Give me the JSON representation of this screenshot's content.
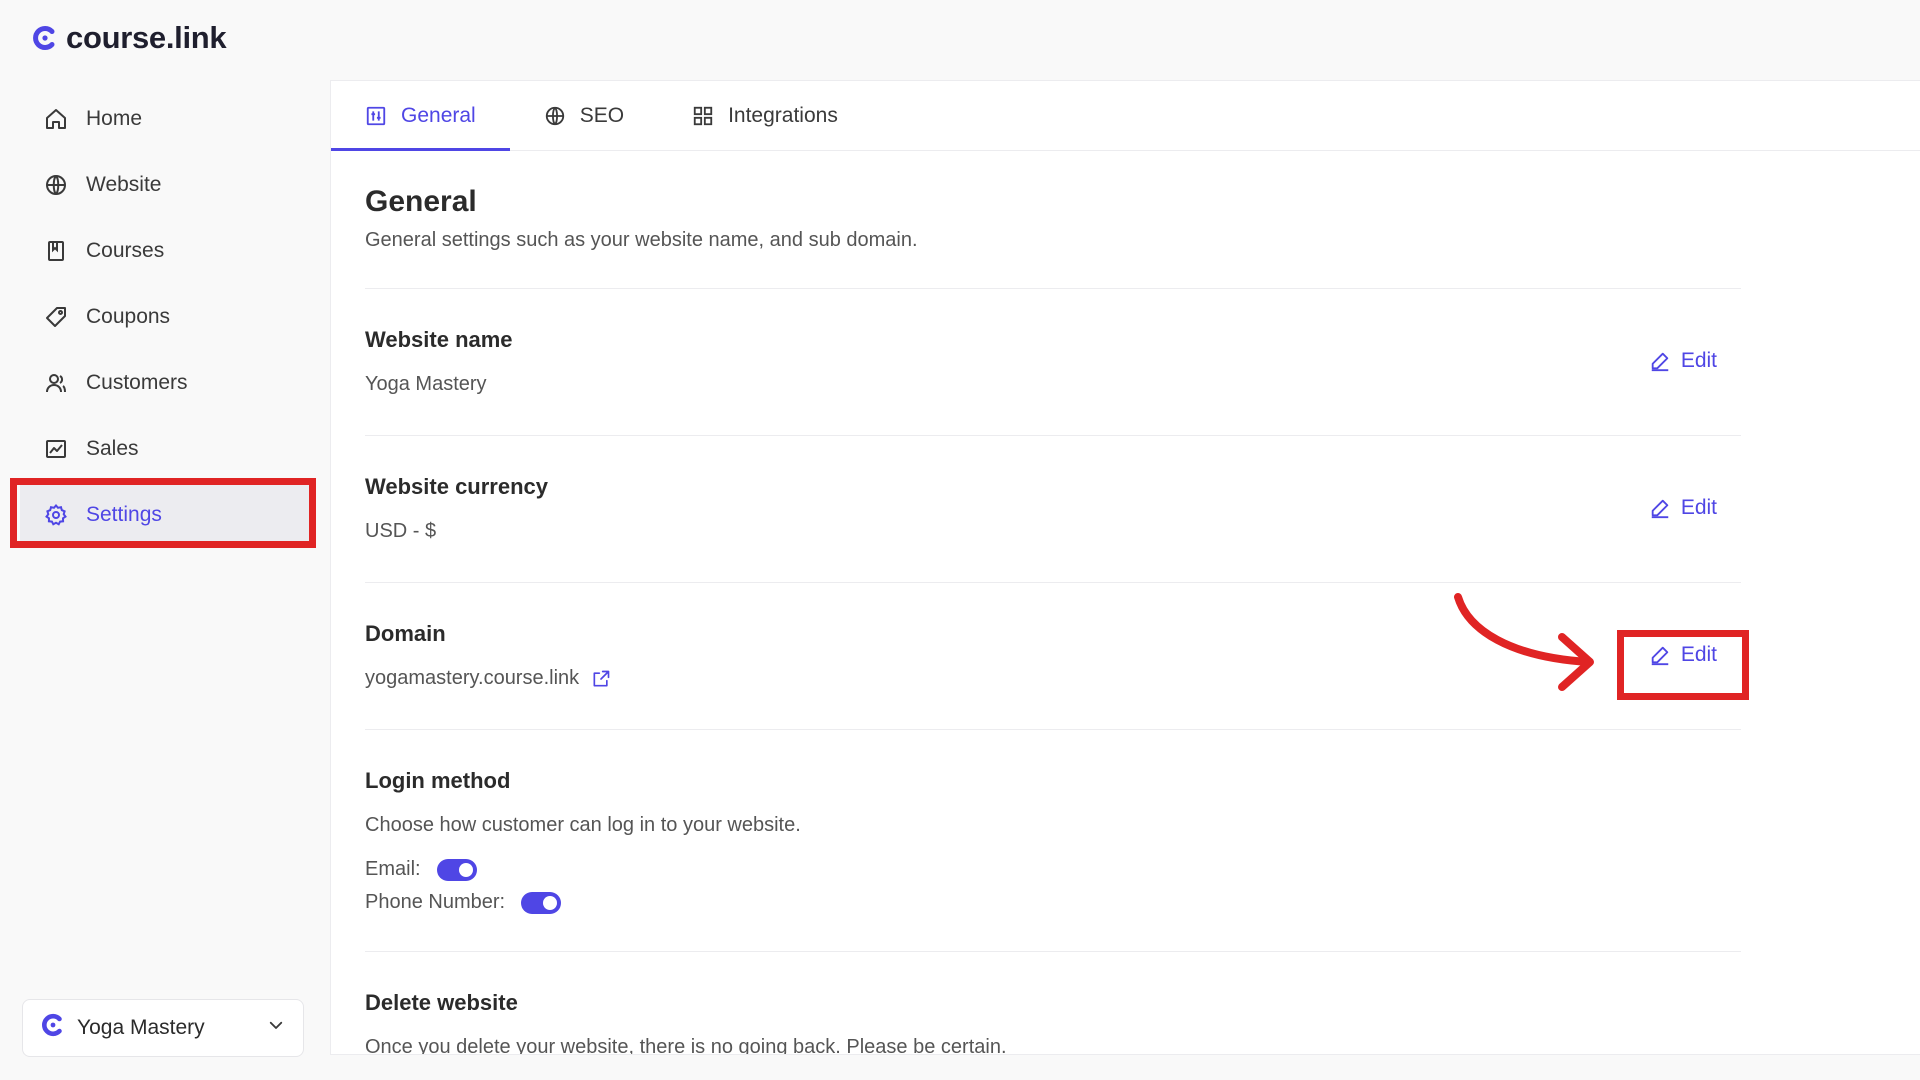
{
  "app": {
    "brand": "course.link",
    "accent": "#4f46e5",
    "annotation_color": "#e02424"
  },
  "sidebar": {
    "items": [
      {
        "label": "Home",
        "icon": "home-icon",
        "active": false
      },
      {
        "label": "Website",
        "icon": "globe-icon",
        "active": false
      },
      {
        "label": "Courses",
        "icon": "book-icon",
        "active": false
      },
      {
        "label": "Coupons",
        "icon": "tag-icon",
        "active": false
      },
      {
        "label": "Customers",
        "icon": "users-icon",
        "active": false
      },
      {
        "label": "Sales",
        "icon": "chart-icon",
        "active": false
      },
      {
        "label": "Settings",
        "icon": "gear-icon",
        "active": true
      }
    ],
    "site_switcher": {
      "label": "Yoga Mastery"
    }
  },
  "tabs": [
    {
      "label": "General",
      "icon": "sliders-icon",
      "active": true
    },
    {
      "label": "SEO",
      "icon": "globe-icon",
      "active": false
    },
    {
      "label": "Integrations",
      "icon": "grid-icon",
      "active": false
    }
  ],
  "page": {
    "title": "General",
    "description": "General settings such as your website name, and sub domain."
  },
  "sections": {
    "website_name": {
      "title": "Website name",
      "value": "Yoga Mastery",
      "action": "Edit"
    },
    "website_currency": {
      "title": "Website currency",
      "value": "USD - $",
      "action": "Edit"
    },
    "domain": {
      "title": "Domain",
      "value": "yogamastery.course.link",
      "action": "Edit"
    },
    "login_method": {
      "title": "Login method",
      "description": "Choose how customer can log in to your website.",
      "email_label": "Email:",
      "email_enabled": true,
      "phone_label": "Phone Number:",
      "phone_enabled": true
    },
    "delete_website": {
      "title": "Delete website",
      "description": "Once you delete your website, there is no going back. Please be certain."
    }
  }
}
